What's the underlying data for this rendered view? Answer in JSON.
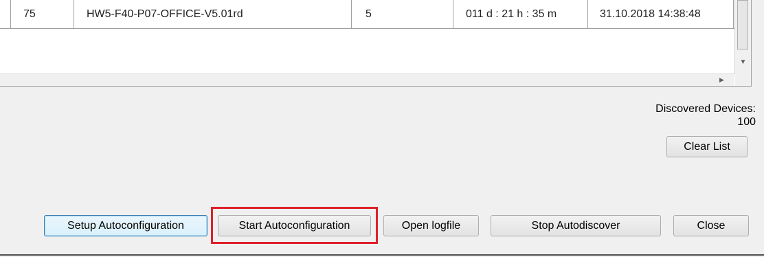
{
  "device_list": {
    "rows": [
      {
        "index": "75",
        "name": "HW5-F40-P07-OFFICE-V5.01rd",
        "value": "5",
        "uptime": "011 d : 21 h : 35 m",
        "timestamp": "31.10.2018 14:38:48"
      }
    ]
  },
  "discovered": {
    "label": "Discovered Devices:",
    "count": "100"
  },
  "buttons": {
    "clear_list": "Clear List",
    "setup_autoconfiguration": "Setup Autoconfiguration",
    "start_autoconfiguration": "Start Autoconfiguration",
    "open_logfile": "Open logfile",
    "stop_autodiscover": "Stop Autodiscover",
    "close": "Close"
  },
  "colors": {
    "highlight": "#e0202a",
    "default_button_border": "#3c7fb1"
  },
  "icons": {
    "scroll_down": "triangle-down",
    "scroll_right": "triangle-right"
  }
}
